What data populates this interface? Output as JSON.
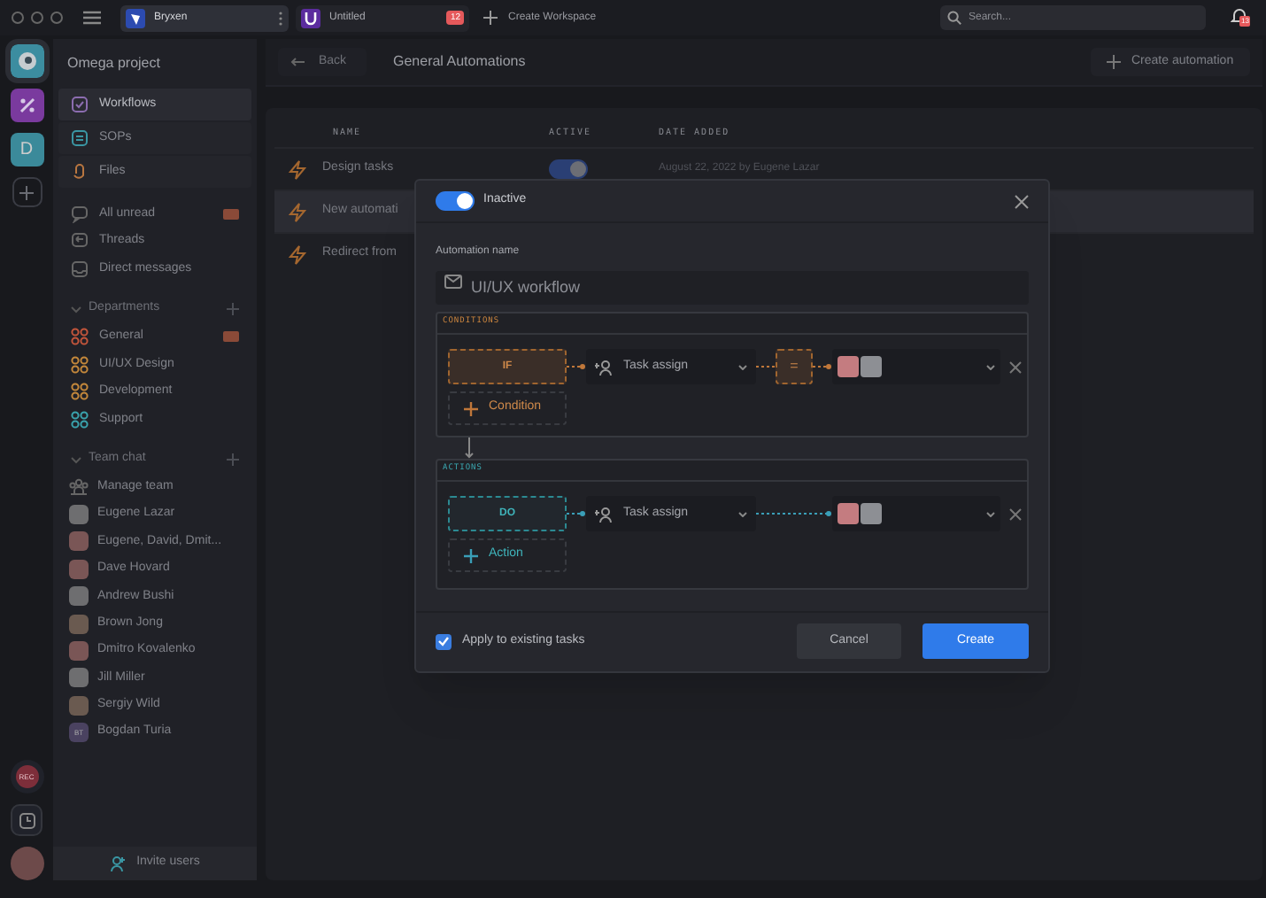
{
  "title_bar": {
    "tabs": [
      {
        "label": "Bryxen",
        "selected": true
      },
      {
        "label": "Untitled",
        "selected": false,
        "badge": "12"
      }
    ],
    "create_workspace": "Create Workspace",
    "search": {
      "placeholder": "Search..."
    },
    "notification_badge": "13"
  },
  "workspace_rail": {
    "items": [
      {
        "kind": "logo",
        "selected": true
      },
      {
        "kind": "logo",
        "selected": false
      },
      {
        "kind": "letter",
        "label": "D",
        "selected": false
      }
    ],
    "record_label": "REC"
  },
  "sidebar": {
    "project": "Omega project",
    "nav": [
      {
        "label": "Workflows",
        "selected": true
      },
      {
        "label": "SOPs",
        "selected": false
      },
      {
        "label": "Files",
        "selected": false
      }
    ],
    "messages": [
      {
        "label": "All unread",
        "has_badge": true
      },
      {
        "label": "Threads",
        "has_badge": false
      },
      {
        "label": "Direct messages",
        "has_badge": false
      }
    ],
    "departments": {
      "title": "Departments",
      "items": [
        {
          "label": "General",
          "color": "#c2553b",
          "has_badge": true
        },
        {
          "label": "UI/UX Design",
          "color": "#c4883b",
          "has_badge": false
        },
        {
          "label": "Development",
          "color": "#c4883b",
          "has_badge": false
        },
        {
          "label": "Support",
          "color": "#3aa3ad",
          "has_badge": false
        }
      ]
    },
    "team_chat": {
      "title": "Team chat",
      "items": [
        {
          "label": "Manage team",
          "kind": "team"
        },
        {
          "label": "Eugene Lazar",
          "kind": "photo"
        },
        {
          "label": "Eugene, David, Dmit...",
          "kind": "group"
        },
        {
          "label": "Dave Hovard",
          "kind": "photo"
        },
        {
          "label": "Andrew Bushi",
          "kind": "photo"
        },
        {
          "label": "Brown Jong",
          "kind": "photo"
        },
        {
          "label": "Dmitro Kovalenko",
          "kind": "photo"
        },
        {
          "label": "Jill Miller",
          "kind": "photo"
        },
        {
          "label": "Sergiy Wild",
          "kind": "photo"
        },
        {
          "label": "Bogdan Turia",
          "kind": "initials",
          "initials": "BT"
        }
      ]
    },
    "invite": "Invite users"
  },
  "main": {
    "back": "Back",
    "title": "General Automations",
    "create": "Create automation",
    "table": {
      "columns": [
        "NAME",
        "ACTIVE",
        "DATE ADDED"
      ],
      "rows": [
        {
          "name": "Design tasks",
          "selected": false,
          "active": true,
          "date": "August 22, 2022 by Eugene Lazar"
        },
        {
          "name": "New automati",
          "selected": true
        },
        {
          "name": "Redirect from",
          "selected": false
        }
      ]
    }
  },
  "modal": {
    "toggle": {
      "on": true,
      "label": "Inactive"
    },
    "name_label": "Automation name",
    "name_value": "UI/UX workflow",
    "blocks": [
      {
        "kind": "conditions",
        "title": "CONDITIONS",
        "block": "IF",
        "field": "Task assign",
        "operator": "=",
        "add": "Condition"
      },
      {
        "kind": "actions",
        "title": "ACTIONS",
        "block": "DO",
        "field": "Task assign",
        "add": "Action"
      }
    ],
    "apply": {
      "label": "Apply to existing tasks",
      "checked": true
    },
    "cancel": "Cancel",
    "create": "Create"
  }
}
